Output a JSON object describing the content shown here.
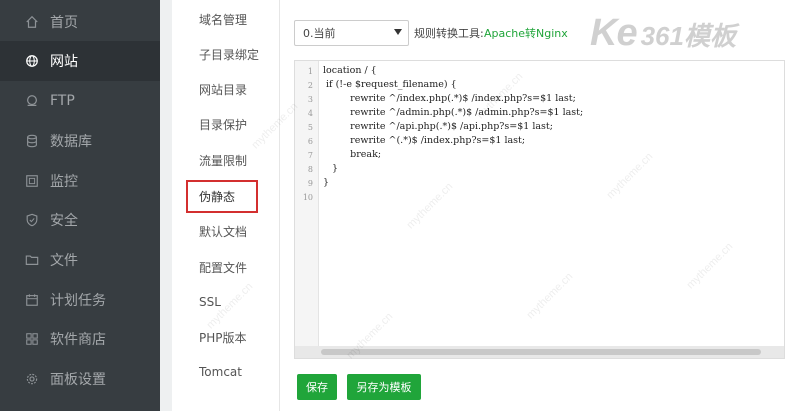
{
  "sidebar": {
    "items": [
      {
        "label": "首页",
        "icon": "home-icon"
      },
      {
        "label": "网站",
        "icon": "globe-icon",
        "active": true
      },
      {
        "label": "FTP",
        "icon": "ftp-icon"
      },
      {
        "label": "数据库",
        "icon": "database-icon"
      },
      {
        "label": "监控",
        "icon": "monitor-icon"
      },
      {
        "label": "安全",
        "icon": "shield-icon"
      },
      {
        "label": "文件",
        "icon": "folder-icon"
      },
      {
        "label": "计划任务",
        "icon": "calendar-icon"
      },
      {
        "label": "软件商店",
        "icon": "apps-icon"
      },
      {
        "label": "面板设置",
        "icon": "gear-icon"
      }
    ]
  },
  "submenu": {
    "items": [
      "域名管理",
      "子目录绑定",
      "网站目录",
      "目录保护",
      "流量限制",
      "伪静态",
      "默认文档",
      "配置文件",
      "SSL",
      "PHP版本",
      "Tomcat"
    ],
    "active_index": 5
  },
  "rewrite": {
    "select_value": "0.当前",
    "tool_label": "规则转换工具:",
    "tool_link": "Apache转Nginx"
  },
  "editor": {
    "line_numbers": [
      "1",
      "2",
      "3",
      "4",
      "5",
      "6",
      "7",
      "8",
      "9",
      "10"
    ],
    "lines": [
      "location / {",
      " if (!-e $request_filename) {",
      "         rewrite ^/index.php(.*)$ /index.php?s=$1 last;",
      "         rewrite ^/admin.php(.*)$ /admin.php?s=$1 last;",
      "         rewrite ^/api.php(.*)$ /api.php?s=$1 last;",
      "         rewrite ^(.*)$ /index.php?s=$1 last;",
      "         break;",
      "   }",
      "}",
      ""
    ]
  },
  "buttons": {
    "save": "保存",
    "save_as_template": "另存为模板"
  },
  "watermark": {
    "logo_ke": "Ke",
    "logo_text": "361模板",
    "text": "mytheme.cn"
  },
  "colors": {
    "sidebar_bg": "#373d41",
    "accent_green": "#20a53a",
    "highlight_red": "#d32f2f"
  }
}
